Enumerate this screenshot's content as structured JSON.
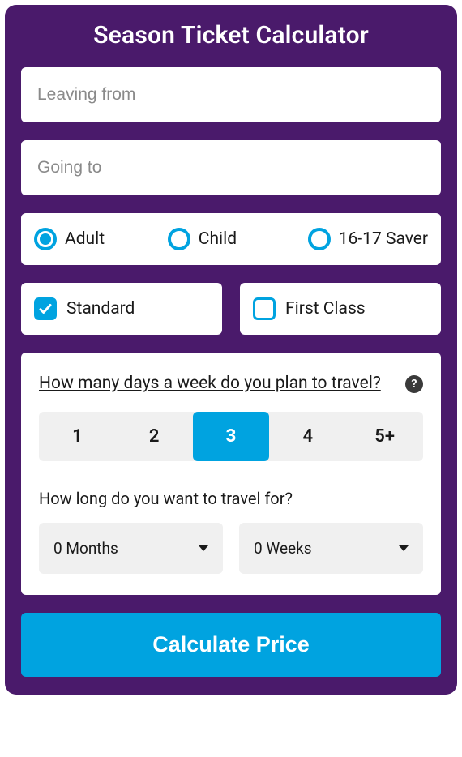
{
  "title": "Season Ticket Calculator",
  "from_placeholder": "Leaving from",
  "to_placeholder": "Going to",
  "passenger": {
    "adult": "Adult",
    "child": "Child",
    "saver": "16-17 Saver"
  },
  "class": {
    "standard": "Standard",
    "first": "First Class"
  },
  "panel": {
    "days_question": "How many days a week do you plan to travel?",
    "days": [
      "1",
      "2",
      "3",
      "4",
      "5+"
    ],
    "selected_day_index": 2,
    "duration_question": "How long do you want to travel for?",
    "months": "0 Months",
    "weeks": "0 Weeks"
  },
  "button": "Calculate Price"
}
